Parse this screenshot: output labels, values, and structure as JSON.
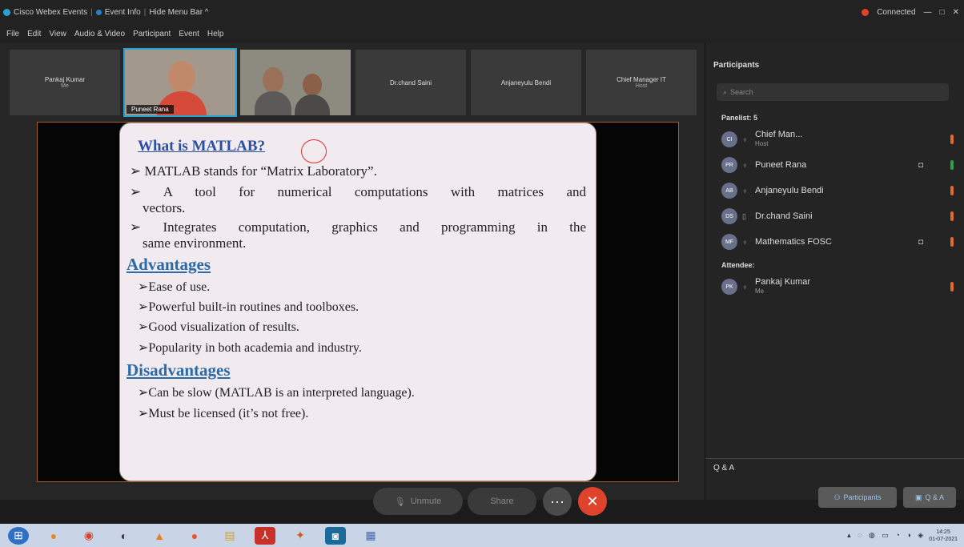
{
  "window": {
    "app_title": "Cisco Webex Events",
    "event_info": "Event Info",
    "hide_menu": "Hide Menu Bar ^",
    "connection_status": "Connected",
    "minimize": "—",
    "maximize": "□",
    "close": "✕"
  },
  "menu": [
    "File",
    "Edit",
    "View",
    "Audio & Video",
    "Participant",
    "Event",
    "Help"
  ],
  "thumbnails": [
    {
      "name": "Pankaj Kumar",
      "sub": "Me"
    },
    {
      "name": "Puneet Rana",
      "sub": ""
    },
    {
      "name": "",
      "sub": ""
    },
    {
      "name": "Dr.chand Saini",
      "sub": ""
    },
    {
      "name": "Anjaneyulu Bendi",
      "sub": ""
    },
    {
      "name": "Chief Manager IT",
      "sub": "Host"
    }
  ],
  "slide": {
    "heading": "What is MATLAB?",
    "bullets": [
      "MATLAB stands for “Matrix Laboratory”.",
      "A tool for numerical computations with matrices and",
      "vectors.",
      "Integrates computation, graphics and programming in the",
      "same environment."
    ],
    "advantages_title": "Advantages",
    "advantages": [
      "Ease of use.",
      "Powerful built-in routines and toolboxes.",
      "Good visualization of results.",
      "Popularity in both academia and industry."
    ],
    "disadvantages_title": "Disadvantages",
    "disadvantages": [
      "Can be slow (MATLAB is an interpreted language).",
      "Must be licensed (it’s not free)."
    ]
  },
  "controls": {
    "unmute": "Unmute",
    "share": "Share",
    "more": "···",
    "leave": "✕"
  },
  "participants": {
    "title": "Participants",
    "search_placeholder": "Search",
    "panelist_header": "Panelist: 5",
    "panelists": [
      {
        "initials": "CI",
        "name": "Chief Man...",
        "role": "Host"
      },
      {
        "initials": "PR",
        "name": "Puneet Rana",
        "role": ""
      },
      {
        "initials": "AB",
        "name": "Anjaneyulu Bendi",
        "role": ""
      },
      {
        "initials": "DS",
        "name": "Dr.chand Saini",
        "role": ""
      },
      {
        "initials": "MF",
        "name": "Mathematics FOSC",
        "role": ""
      }
    ],
    "attendee_header": "Attendee:",
    "attendees": [
      {
        "initials": "PK",
        "name": "Pankaj Kumar",
        "role": "Me"
      }
    ],
    "qa_label": "Q & A",
    "participants_button": "Participants",
    "qa_button": "Q & A"
  },
  "taskbar": {
    "time": "14:25",
    "date": "01-07-2021"
  },
  "colors": {
    "accent": "#2aa1d3",
    "leave": "#e0432c",
    "mic_on": "#2aa14a",
    "mic_off": "#e06a2a"
  }
}
